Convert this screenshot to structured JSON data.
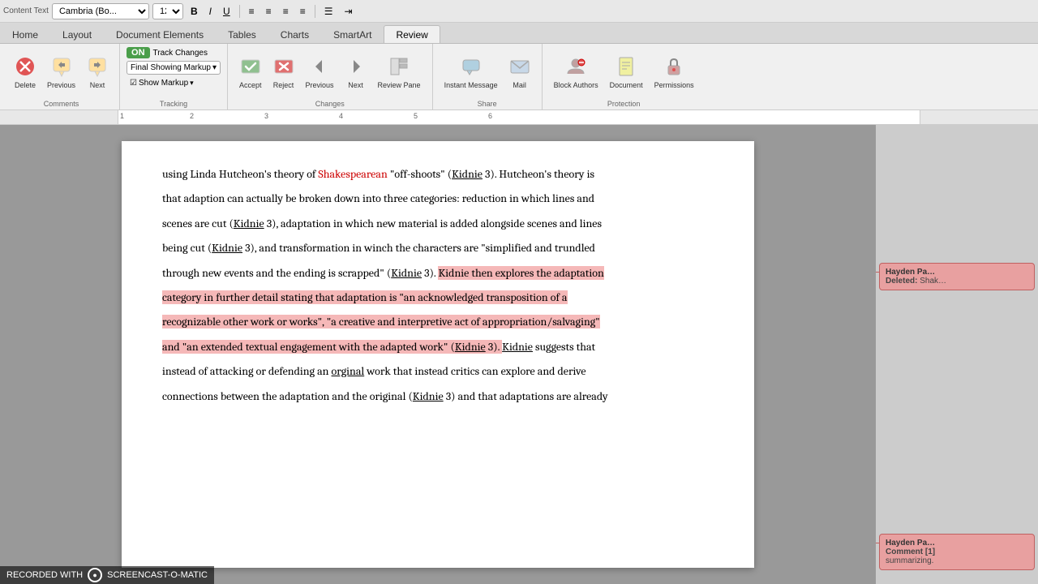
{
  "toolbar": {
    "font_name": "Cambria (Bo...",
    "font_size": "12",
    "bold_label": "B",
    "italic_label": "I",
    "underline_label": "U"
  },
  "tabs": [
    {
      "label": "Home",
      "active": false
    },
    {
      "label": "Layout",
      "active": false
    },
    {
      "label": "Document Elements",
      "active": false
    },
    {
      "label": "Tables",
      "active": false
    },
    {
      "label": "Charts",
      "active": false
    },
    {
      "label": "SmartArt",
      "active": false
    },
    {
      "label": "Review",
      "active": true
    }
  ],
  "ribbon": {
    "comments_group": "Comments",
    "tracking_group": "Tracking",
    "changes_group": "Changes",
    "share_group": "Share",
    "protection_group": "Protection",
    "delete_label": "Delete",
    "previous_label": "Previous",
    "next_label": "Next",
    "track_changes_on": "ON",
    "track_changes_label": "Track Changes",
    "markup_dropdown": "Final Showing Markup",
    "show_markup_label": "Show Markup",
    "accept_label": "Accept",
    "reject_label": "Reject",
    "prev_change_label": "Previous",
    "next_change_label": "Next",
    "review_pane_label": "Review Pane",
    "instant_msg_label": "Instant Message",
    "mail_label": "Mail",
    "block_authors_label": "Block Authors",
    "document_label": "Document",
    "permissions_label": "Permissions"
  },
  "document": {
    "paragraphs": [
      {
        "id": 1,
        "segments": [
          {
            "text": "using Linda Hutcheon’s theory of ",
            "style": "normal"
          },
          {
            "text": "Shakespearean",
            "style": "red"
          },
          {
            "text": " “off-shoots” (",
            "style": "normal"
          },
          {
            "text": "Kidnie",
            "style": "underline"
          },
          {
            "text": " 3). Hutcheon’s theory is",
            "style": "normal"
          }
        ]
      },
      {
        "id": 2,
        "segments": [
          {
            "text": "that adaption can actually be broken down into three categories: reduction in which lines and",
            "style": "normal"
          }
        ]
      },
      {
        "id": 3,
        "segments": [
          {
            "text": "scenes are cut (",
            "style": "normal"
          },
          {
            "text": "Kidnie",
            "style": "underline"
          },
          {
            "text": " 3), adaptation in which new material is added alongside scenes and lines",
            "style": "normal"
          }
        ]
      },
      {
        "id": 4,
        "segments": [
          {
            "text": "being cut (",
            "style": "normal"
          },
          {
            "text": "Kidnie",
            "style": "underline"
          },
          {
            "text": " 3), and transformation in winch the characters are “simplified and trundled",
            "style": "normal"
          }
        ]
      },
      {
        "id": 5,
        "segments": [
          {
            "text": "through new events and the ending is scrapped” (",
            "style": "normal"
          },
          {
            "text": "Kidnie",
            "style": "underline"
          },
          {
            "text": " 3). ",
            "style": "normal"
          },
          {
            "text": "Kidnie then explores the adaptation",
            "style": "highlight-red"
          }
        ]
      },
      {
        "id": 6,
        "segments": [
          {
            "text": "category in further detail stating that adaptation is “an acknowledged transposition of a",
            "style": "highlight-red"
          }
        ]
      },
      {
        "id": 7,
        "segments": [
          {
            "text": "recognizable other work or works”, “a creative and interpretive act of appropriation/salvaging”",
            "style": "highlight-red"
          }
        ]
      },
      {
        "id": 8,
        "segments": [
          {
            "text": "and “an extended textual engagement with the adapted work” (",
            "style": "highlight-red"
          },
          {
            "text": "Kidnie",
            "style": "highlight-red underline"
          },
          {
            "text": " 3). ",
            "style": "highlight-red"
          },
          {
            "text": "Kidnie",
            "style": "underline"
          },
          {
            "text": " suggests that",
            "style": "normal"
          }
        ]
      },
      {
        "id": 9,
        "segments": [
          {
            "text": "instead of attacking or defending an ",
            "style": "normal"
          },
          {
            "text": "orginal",
            "style": "underline"
          },
          {
            "text": " work that instead critics can explore and derive",
            "style": "normal"
          }
        ]
      },
      {
        "id": 10,
        "segments": [
          {
            "text": "connections between the adaptation and the original (",
            "style": "normal"
          },
          {
            "text": "Kidnie",
            "style": "underline"
          },
          {
            "text": " 3) and that adaptations are already",
            "style": "normal"
          }
        ]
      }
    ]
  },
  "comments": [
    {
      "id": 1,
      "author": "Hayden Pa…",
      "type": "Deleted",
      "text": "Shak…",
      "position": "top"
    },
    {
      "id": 2,
      "author": "Hayden Pa…",
      "type": "Comment [1]",
      "text": "summarizing.",
      "position": "bottom"
    }
  ],
  "screencast": {
    "recorded_with": "RECORDED WITH",
    "brand": "SCREENCAST-O-MATIC"
  }
}
